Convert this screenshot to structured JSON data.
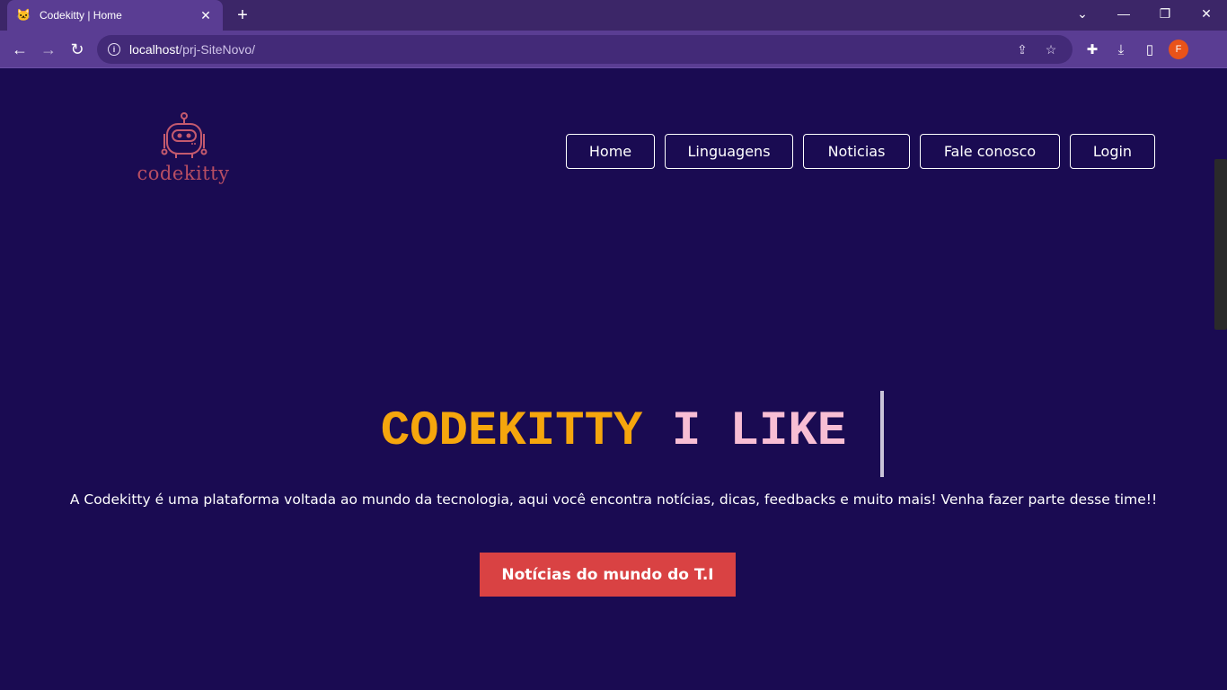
{
  "browser": {
    "tab_title": "Codekitty | Home",
    "tab_favicon": "🐱",
    "url_host": "localhost",
    "url_path": "/prj-SiteNovo/",
    "profile_initial": "F",
    "icons": {
      "back": "←",
      "forward": "→",
      "reload": "↻",
      "share": "⇪",
      "bookmark": "☆",
      "extensions": "✚",
      "download": "⤓",
      "sidepanel": "▯",
      "new_tab": "+",
      "tab_close": "✕",
      "tab_search": "⌄",
      "minimize": "—",
      "restore": "❐",
      "close": "✕"
    }
  },
  "site": {
    "logo_text": "codekitty",
    "nav": [
      "Home",
      "Linguagens",
      "Noticias",
      "Fale conosco",
      "Login"
    ],
    "hero_word1": "CODEKITTY",
    "hero_word2": "I LIKE",
    "hero_description": "A Codekitty é uma plataforma voltada ao mundo da tecnologia, aqui você encontra notícias, dicas, feedbacks e muito mais! Venha fazer parte desse time!!",
    "cta_label": "Notícias do mundo do T.I"
  },
  "colors": {
    "page_bg": "#1a0b52",
    "hero_word1": "#f5a60d",
    "hero_word2": "#f8bed4",
    "cta_bg": "#d94243",
    "logo": "#b84e63"
  }
}
